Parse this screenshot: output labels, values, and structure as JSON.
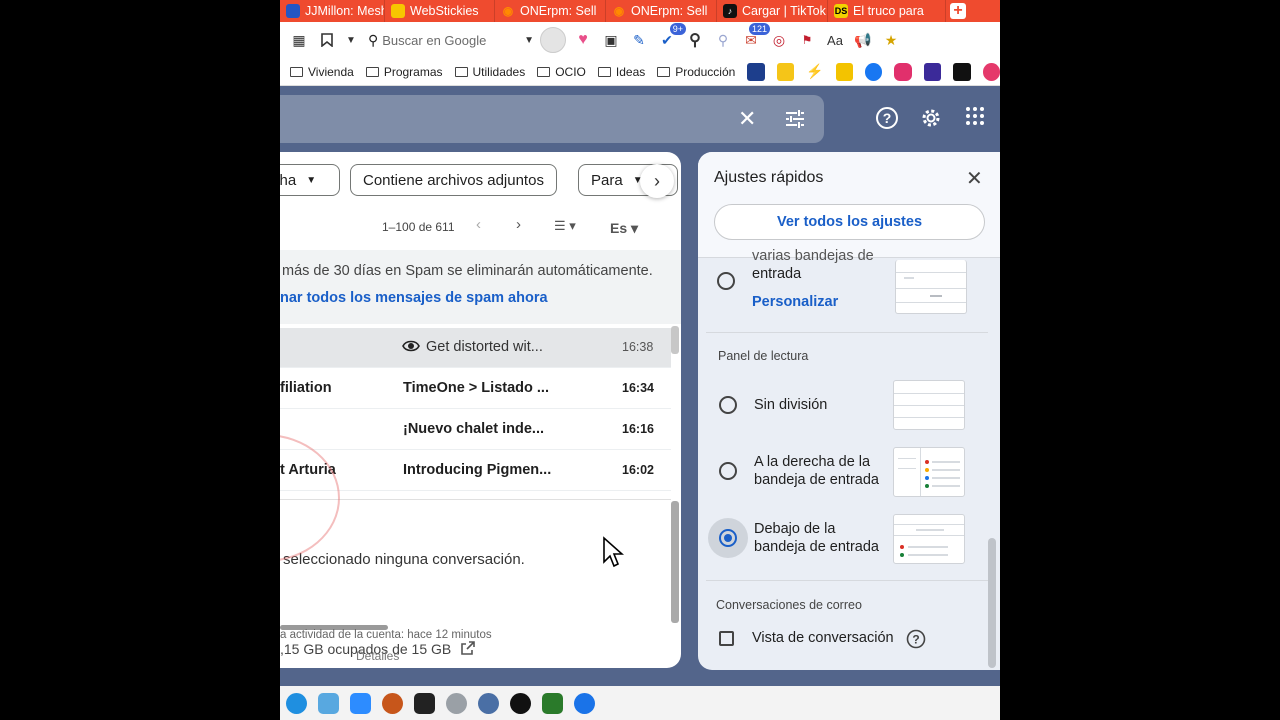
{
  "browser": {
    "tabs": [
      {
        "label": "JJMillon: Mesh",
        "icon": "flag-icon",
        "color": "#2456c4"
      },
      {
        "label": "WebStickies",
        "icon": "webstickies-icon",
        "color": "#f7c600"
      },
      {
        "label": "ONErpm: Sell",
        "icon": "onerpm-icon",
        "color": "#ff8a00"
      },
      {
        "label": "ONErpm: Sell",
        "icon": "onerpm-icon",
        "color": "#ff8a00"
      },
      {
        "label": "Cargar | TikTok",
        "icon": "tiktok-icon",
        "color": "#111111"
      },
      {
        "label": "El truco para",
        "icon": "ds-icon",
        "color": "#f2d200"
      }
    ],
    "ds_text": "DS",
    "search_placeholder": "Buscar en Google",
    "badges": {
      "ext1": "9+",
      "ext2": "121"
    },
    "aa_label": "Aa",
    "bookmarks": [
      "Vivienda",
      "Programas",
      "Utilidades",
      "OCIO",
      "Ideas",
      "Producción"
    ]
  },
  "gmail": {
    "filter_chips": [
      "cha",
      "Contiene archivos adjuntos",
      "Para"
    ],
    "pager_text": "1–100 de 611",
    "view_label": "Es",
    "spam_notice": "más de 30 días en Spam se eliminarán automáticamente.",
    "spam_link": "nar todos los mensajes de spam ahora",
    "emails": [
      {
        "sender": "",
        "subject": "Get distorted wit...",
        "time": "16:38",
        "read": true
      },
      {
        "sender": "filiation",
        "subject": "TimeOne > Listado ...",
        "time": "16:34",
        "read": false
      },
      {
        "sender": "",
        "subject": "¡Nuevo chalet inde...",
        "time": "16:16",
        "read": false
      },
      {
        "sender": "t Arturia",
        "subject": "Introducing Pigmen...",
        "time": "16:02",
        "read": false
      }
    ],
    "no_selection": "seleccionado ninguna conversación.",
    "activity": "a actividad de la cuenta: hace 12 minutos",
    "storage": ",15 GB ocupados de 15 GB",
    "details": "Detalles"
  },
  "quick_settings": {
    "title": "Ajustes rápidos",
    "see_all": "Ver todos los ajustes",
    "inbox_option_clipped": "varias bandejas de",
    "inbox_option_line2": "entrada",
    "customize": "Personalizar",
    "reading_pane_title": "Panel de lectura",
    "reading_options": [
      {
        "label": "Sin división",
        "selected": false
      },
      {
        "label": "A la derecha de la\nbandeja de entrada",
        "selected": false
      },
      {
        "label": "Debajo de la\nbandeja de entrada",
        "selected": true
      }
    ],
    "threads_title": "Conversaciones de correo",
    "threads_option": "Vista de conversación",
    "threads_checked": false
  },
  "colors": {
    "accent": "#1a5fc8",
    "header_bg": "#53658b",
    "tab_bar": "#ef4b2f"
  }
}
